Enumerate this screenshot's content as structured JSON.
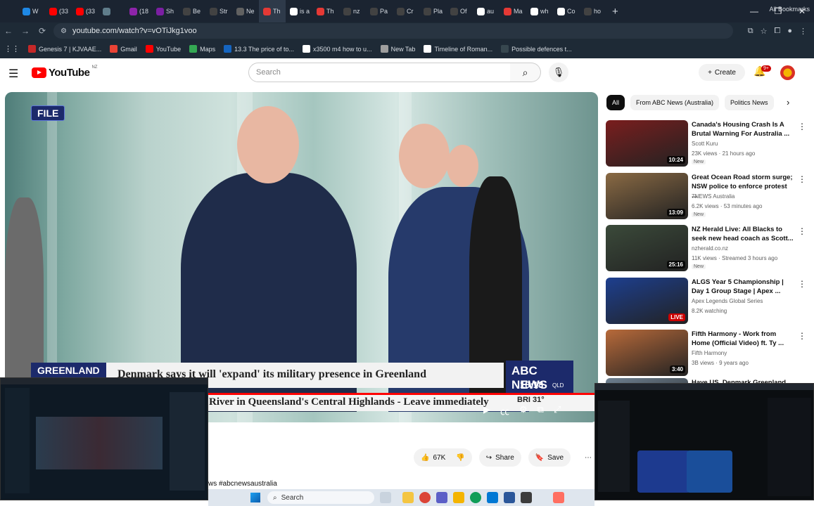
{
  "browser": {
    "tabs": [
      {
        "label": "W",
        "color": "#1e88e5"
      },
      {
        "label": "(33",
        "color": "#ff0000"
      },
      {
        "label": "(33",
        "color": "#ff0000"
      },
      {
        "label": "",
        "color": "#607d8b"
      },
      {
        "label": "(18",
        "color": "#8e24aa"
      },
      {
        "label": "Sh",
        "color": "#7b1fa2"
      },
      {
        "label": "Be",
        "color": "#424242"
      },
      {
        "label": "Str",
        "color": "#424242"
      },
      {
        "label": "Ne",
        "color": "#616161"
      },
      {
        "label": "Th",
        "color": "#e53935"
      },
      {
        "label": "is a",
        "color": "#ffffff"
      },
      {
        "label": "Th",
        "color": "#e53935"
      },
      {
        "label": "nz",
        "color": "#424242"
      },
      {
        "label": "Pa",
        "color": "#424242"
      },
      {
        "label": "Cr",
        "color": "#424242"
      },
      {
        "label": "Pla",
        "color": "#424242"
      },
      {
        "label": "Of",
        "color": "#424242"
      },
      {
        "label": "au",
        "color": "#ffffff"
      },
      {
        "label": "Ma",
        "color": "#e53935"
      },
      {
        "label": "wh",
        "color": "#ffffff"
      },
      {
        "label": "Co",
        "color": "#ffffff"
      },
      {
        "label": "ho",
        "color": "#424242"
      }
    ],
    "url": "youtube.com/watch?v=vOTiJkg1voo",
    "bookmarks": [
      {
        "label": "Genesis 7 | KJVAAE...",
        "color": "#c62828"
      },
      {
        "label": "Gmail",
        "color": "#ea4335"
      },
      {
        "label": "YouTube",
        "color": "#ff0000"
      },
      {
        "label": "Maps",
        "color": "#34a853"
      },
      {
        "label": "13.3 The price of to...",
        "color": "#1565c0"
      },
      {
        "label": "x3500 m4 how to u...",
        "color": "#ffffff"
      },
      {
        "label": "New Tab",
        "color": "#9e9e9e"
      },
      {
        "label": "Timeline of Roman...",
        "color": "#ffffff"
      },
      {
        "label": "Possible defences t...",
        "color": "#37474f"
      }
    ],
    "all_bookmarks": "All Bookmarks"
  },
  "youtube": {
    "logo_text": "YouTube",
    "country": "NZ",
    "search_placeholder": "Search",
    "create_label": "Create",
    "notif_count": "9+",
    "video": {
      "file_tag": "FILE",
      "tag": "GREENLAND",
      "headline": "Denmark says it will 'expand' its military presence in Greenland",
      "ticker": "River in Queensland's Central Highlands - Leave immediately",
      "network": "ABC NEWS",
      "time": "18:18",
      "tz": "QLD",
      "weather": "BRI  31°",
      "progress": 1.0
    },
    "actions": {
      "likes": "67K",
      "share": "Share",
      "save": "Save"
    },
    "description_snippet": "ws #abcnewsaustralia",
    "chips": [
      "All",
      "From ABC News (Australia)",
      "Politics News"
    ],
    "recommendations": [
      {
        "title": "Canada's Housing Crash Is A Brutal Warning For Australia ...",
        "channel": "Scott Kuru",
        "meta": "23K views · 21 hours ago",
        "badge": "New",
        "duration": "10:24",
        "thumb": "#7a1e1e"
      },
      {
        "title": "Great Ocean Road storm surge; NSW police to enforce protest ...",
        "channel": "7NEWS Australia",
        "meta": "6.2K views · 53 minutes ago",
        "badge": "New",
        "duration": "13:09",
        "thumb": "#8a6a44"
      },
      {
        "title": "NZ Herald Live: All Blacks to seek new head coach as Scott...",
        "channel": "nzherald.co.nz",
        "meta": "11K views · Streamed 3 hours ago",
        "badge": "New",
        "duration": "25:16",
        "thumb": "#3b4a3a"
      },
      {
        "title": "ALGS Year 5 Championship | Day 1 Group Stage | Apex ...",
        "channel": "Apex Legends Global Series",
        "meta": "8.2K watching",
        "badge": "",
        "duration": "LIVE",
        "thumb": "#1d3f8f"
      },
      {
        "title": "Fifth Harmony - Work from Home (Official Video) ft. Ty ...",
        "channel": "Fifth Harmony",
        "meta": "3B views · 9 years ago",
        "badge": "",
        "duration": "3:40",
        "thumb": "#b86a3a"
      },
      {
        "title": "Have US, Denmark Greenland",
        "channel": "",
        "meta": "",
        "badge": "",
        "duration": "",
        "thumb": "#6d7f8f"
      }
    ]
  },
  "taskbar": {
    "search_label": "Search"
  }
}
